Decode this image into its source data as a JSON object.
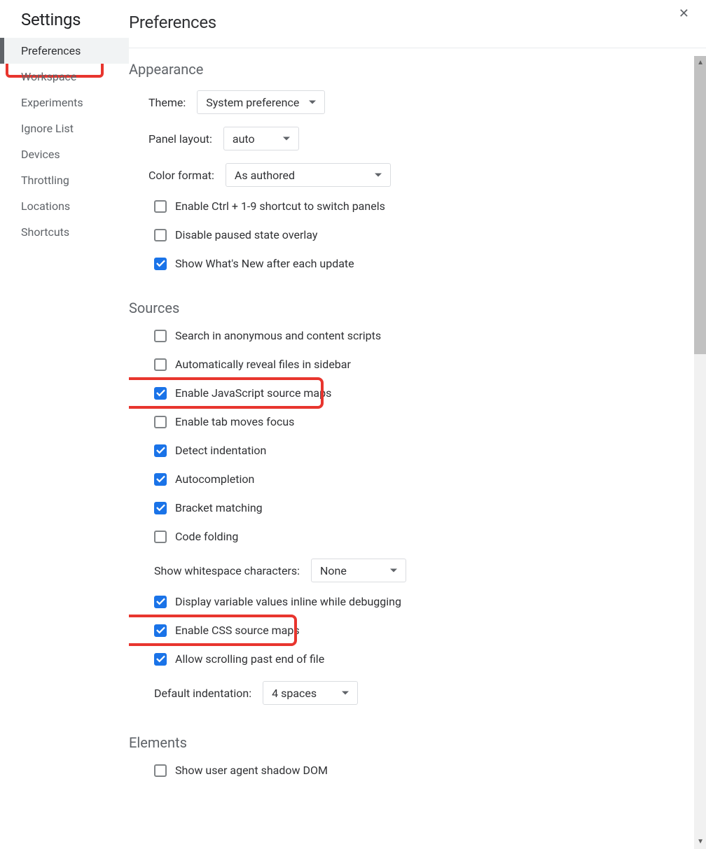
{
  "sidebar": {
    "title": "Settings",
    "items": [
      {
        "label": "Preferences",
        "active": true
      },
      {
        "label": "Workspace",
        "active": false
      },
      {
        "label": "Experiments",
        "active": false
      },
      {
        "label": "Ignore List",
        "active": false
      },
      {
        "label": "Devices",
        "active": false
      },
      {
        "label": "Throttling",
        "active": false
      },
      {
        "label": "Locations",
        "active": false
      },
      {
        "label": "Shortcuts",
        "active": false
      }
    ]
  },
  "main": {
    "title": "Preferences"
  },
  "appearance": {
    "title": "Appearance",
    "theme_label": "Theme:",
    "theme_value": "System preference",
    "panel_label": "Panel layout:",
    "panel_value": "auto",
    "color_label": "Color format:",
    "color_value": "As authored",
    "chk_shortcut": "Enable Ctrl + 1-9 shortcut to switch panels",
    "chk_overlay": "Disable paused state overlay",
    "chk_whatsnew": "Show What's New after each update"
  },
  "sources": {
    "title": "Sources",
    "chk_search": "Search in anonymous and content scripts",
    "chk_reveal": "Automatically reveal files in sidebar",
    "chk_jsmap": "Enable JavaScript source maps",
    "chk_tabfocus": "Enable tab moves focus",
    "chk_indent": "Detect indentation",
    "chk_autocomplete": "Autocompletion",
    "chk_bracket": "Bracket matching",
    "chk_fold": "Code folding",
    "whitespace_label": "Show whitespace characters:",
    "whitespace_value": "None",
    "chk_inline": "Display variable values inline while debugging",
    "chk_cssmap": "Enable CSS source maps",
    "chk_scrollpast": "Allow scrolling past end of file",
    "defaultindent_label": "Default indentation:",
    "defaultindent_value": "4 spaces"
  },
  "elements": {
    "title": "Elements",
    "chk_shadow": "Show user agent shadow DOM"
  }
}
